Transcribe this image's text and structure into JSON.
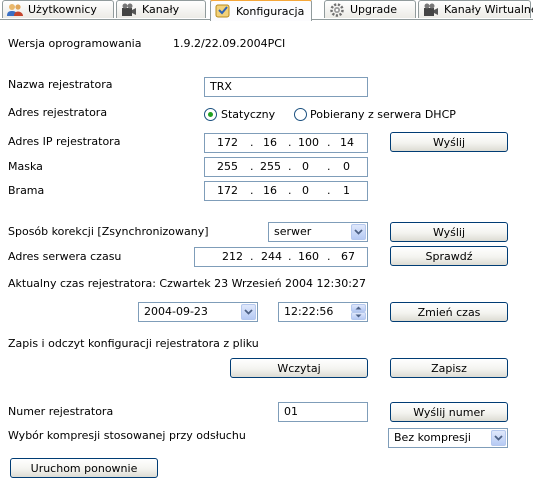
{
  "tabs": [
    {
      "label": "Użytkownicy",
      "icon": "users-icon"
    },
    {
      "label": "Kanały",
      "icon": "film-channel-icon"
    },
    {
      "label": "Konfiguracja",
      "icon": "config-icon"
    },
    {
      "label": "Upgrade",
      "icon": "gear-icon"
    },
    {
      "label": "Kanały Wirtualne",
      "icon": "film-channel-icon"
    }
  ],
  "firmware": {
    "label": "Wersja oprogramowania",
    "value": "1.9.2/22.09.2004PCI"
  },
  "recorder_name": {
    "label": "Nazwa rejestratora",
    "value": "TRX"
  },
  "address_mode": {
    "label": "Adres rejestratora",
    "option_static": "Statyczny",
    "option_dhcp": "Pobierany z serwera DHCP",
    "selected": "Statyczny"
  },
  "ip": {
    "label": "Adres IP rejestratora",
    "octets": [
      "172",
      "16",
      "100",
      "14"
    ]
  },
  "mask": {
    "label": "Maska",
    "octets": [
      "255",
      "255",
      "0",
      "0"
    ]
  },
  "gateway": {
    "label": "Brama",
    "octets": [
      "172",
      "16",
      "0",
      "1"
    ]
  },
  "send_button": "Wyślij",
  "correction": {
    "label": "Sposób korekcji [Zsynchronizowany]",
    "value": "serwer",
    "button": "Wyślij"
  },
  "time_server": {
    "label": "Adres serwera czasu",
    "octets": [
      "212",
      "244",
      "160",
      "67"
    ],
    "button": "Sprawdź"
  },
  "current_time": {
    "text": "Aktualny czas rejestratora: Czwartek 23 Wrzesień 2004 12:30:27"
  },
  "set_time": {
    "date": "2004-09-23",
    "time": "12:22:56",
    "button": "Zmień czas"
  },
  "config_file": {
    "label": "Zapis i odczyt konfiguracji rejestratora z pliku",
    "load": "Wczytaj",
    "save": "Zapisz"
  },
  "recorder_number": {
    "label": "Numer rejestratora",
    "value": "01",
    "button": "Wyślij numer"
  },
  "compression": {
    "label": "Wybór kompresji stosowanej przy odsłuchu",
    "value": "Bez kompresji"
  },
  "restart_button": "Uruchom ponownie",
  "colors": {
    "tab_active_accent": "#f5a73a",
    "radio_dot": "#21a121",
    "field_border": "#7f9db9",
    "button_border": "#003c74"
  }
}
